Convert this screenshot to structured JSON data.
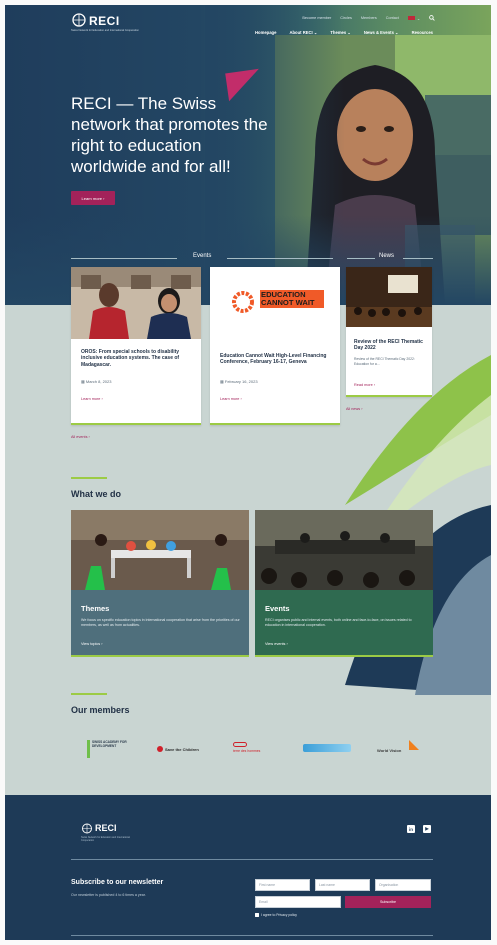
{
  "brand": {
    "name": "RECI",
    "subtitle": "Swiss Network for Education and International Cooperation"
  },
  "topbar": {
    "links": [
      "Become member",
      "Circles",
      "Members",
      "Contact"
    ],
    "lang": "de"
  },
  "nav": {
    "items": [
      "Homepage",
      "About RECI ⌄",
      "Themes ⌄",
      "News & Events ⌄",
      "Resources"
    ]
  },
  "hero": {
    "title": "RECI — The Swiss network that promotes the right to education worldwide and for all!",
    "button": "Learn more ›"
  },
  "sections": {
    "events_label": "Events",
    "news_label": "News"
  },
  "events": [
    {
      "title": "OROS: From special schools to disability inclusive education systems. The case of Madagascar.",
      "date": "March 8, 2023",
      "link": "Learn more ›"
    },
    {
      "title": "Education Cannot Wait High-Level Financing Conference, February 16-17, Geneva",
      "date": "February 16, 2023",
      "link": "Learn more ›",
      "logo_text": "EDUCATION CANNOT WAIT"
    }
  ],
  "events_all": "All events ›",
  "news": [
    {
      "title": "Review of the RECI Thematic Day 2022",
      "text": "Review of the RECI Thematic Day 2022: Education for a…",
      "link": "Read more ›"
    }
  ],
  "news_all": "All news ›",
  "what_we_do": {
    "heading": "What we do",
    "items": [
      {
        "title": "Themes",
        "text": "We focus on specific education topics in international cooperation that arise from the priorities of our members, as well as from actualities.",
        "link": "View topics ›"
      },
      {
        "title": "Events",
        "text": "RECI organises public and internal events, both online and face-to-face, on issues related to education in international cooperation.",
        "link": "View events ›"
      }
    ]
  },
  "members": {
    "heading": "Our members",
    "logos": [
      "SWISS ACADEMY FOR DEVELOPMENT",
      "Save the Children",
      "terre des hommes",
      "",
      "World Vision"
    ]
  },
  "footer": {
    "newsletter_title": "Subscribe to our newsletter",
    "newsletter_text": "Our newsletter is published 4 to 6 times a year.",
    "fields": {
      "first_name": "First name",
      "last_name": "Last name",
      "organisation": "Organisation",
      "email": "Email"
    },
    "subscribe": "Subscribe",
    "privacy": "I agree to Privacy policy",
    "social": [
      "in",
      "▶"
    ]
  },
  "colors": {
    "navy": "#1e3a57",
    "magenta": "#a3225a",
    "green": "#9ccb45",
    "sage": "#c9d5d2"
  }
}
